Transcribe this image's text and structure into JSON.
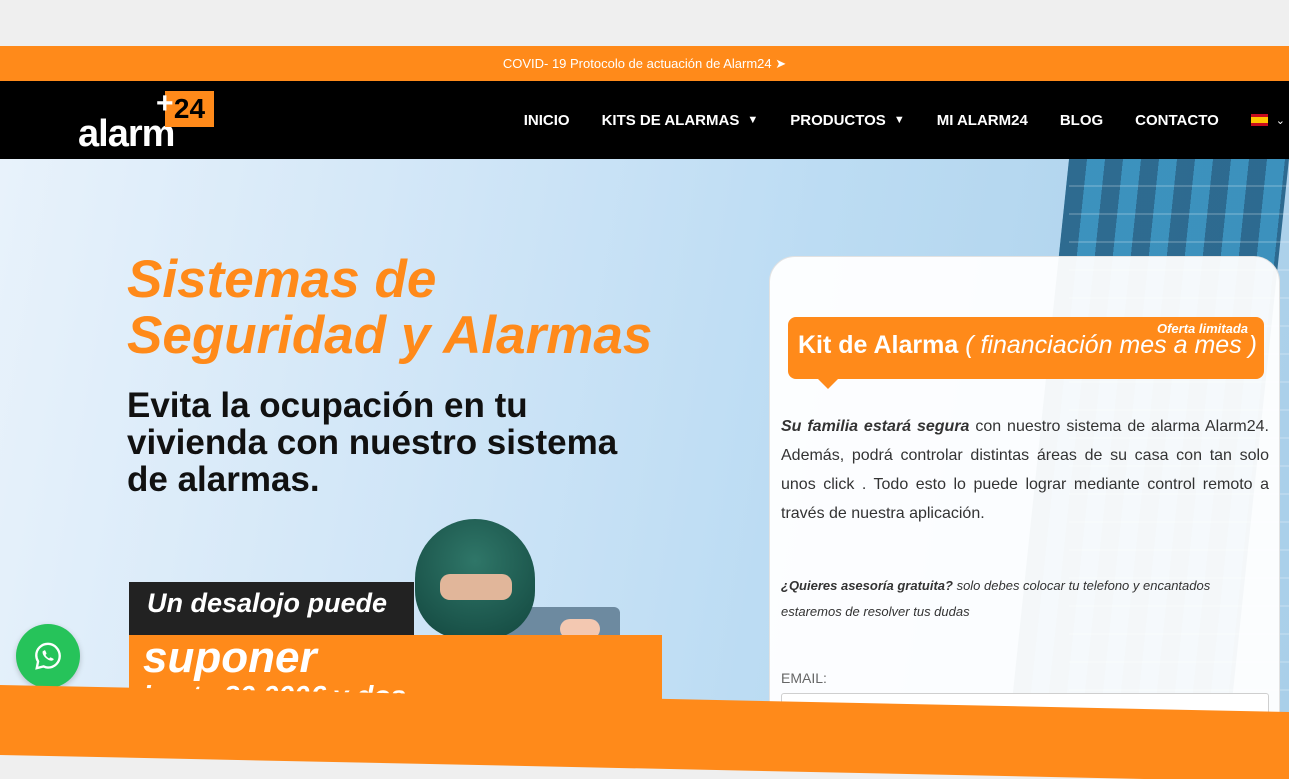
{
  "covid_banner": "COVID- 19 Protocolo de actuación de Alarm24 ➤",
  "logo": {
    "text": "alarm",
    "plus": "+",
    "badge": "24"
  },
  "nav": {
    "items": [
      {
        "label": "INICIO",
        "dropdown": false
      },
      {
        "label": "KITS DE ALARMAS",
        "dropdown": true
      },
      {
        "label": "PRODUCTOS",
        "dropdown": true
      },
      {
        "label": "MI ALARM24",
        "dropdown": false
      },
      {
        "label": "BLOG",
        "dropdown": false
      },
      {
        "label": "CONTACTO",
        "dropdown": false
      }
    ],
    "language_caret": "⌄"
  },
  "hero": {
    "headline": "Sistemas de Seguridad y Alarmas",
    "subheadline": "Evita la ocupación en tu vivienda con nuestro sistema de alarmas.",
    "banner_top": "Un desalojo puede",
    "banner_big": "suponer",
    "banner_small": "hasta 30.000€ y dos"
  },
  "card": {
    "oferta": "Oferta limitada",
    "kit_title": "Kit de  Alarma",
    "kit_financing": "( financiación mes a mes )",
    "body_bold": "Su familia estará segura",
    "body_text": " con nuestro sistema de alarma Alarm24. Además, podrá controlar distintas áreas de su casa con tan solo unos click . Todo esto lo puede lograr mediante control remoto a través de nuestra aplicación.",
    "asesoria_bold": "¿Quieres asesoría gratuita?",
    "asesoria_text": "  solo debes colocar tu telefono y encantados estaremos de resolver tus dudas",
    "email_label": "EMAIL:"
  },
  "colors": {
    "accent": "#ff8a1a",
    "nav_bg": "#000000",
    "whatsapp": "#26c35a"
  }
}
